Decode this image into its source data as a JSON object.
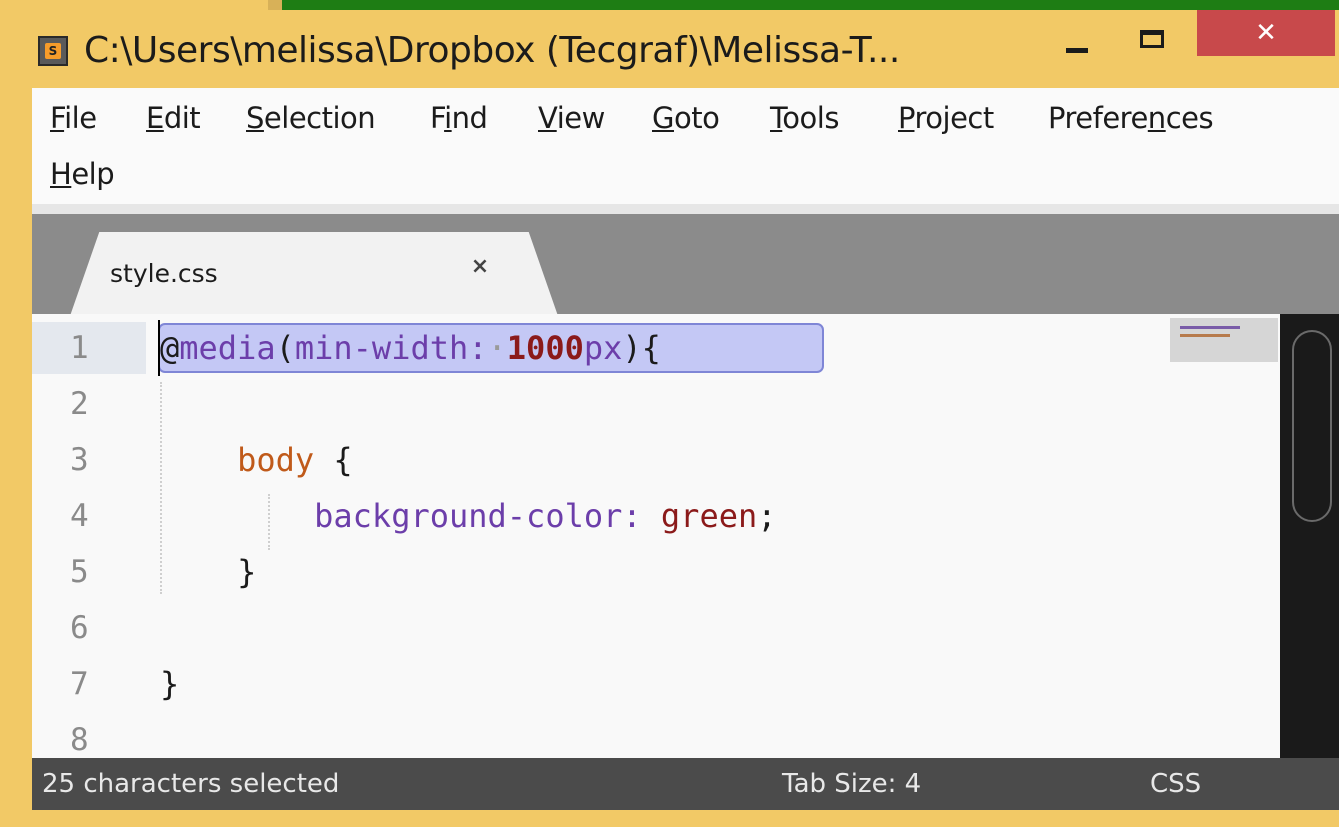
{
  "window": {
    "title": "C:\\Users\\melissa\\Dropbox (Tecgraf)\\Melissa-T...",
    "app_icon": "sublime-text-icon",
    "close_glyph": "✕"
  },
  "menu": {
    "items": [
      {
        "label": "File",
        "acc": "F"
      },
      {
        "label": "Edit",
        "acc": "E"
      },
      {
        "label": "Selection",
        "acc": "S"
      },
      {
        "label": "Find",
        "acc": "i"
      },
      {
        "label": "View",
        "acc": "V"
      },
      {
        "label": "Goto",
        "acc": "G"
      },
      {
        "label": "Tools",
        "acc": "T"
      },
      {
        "label": "Project",
        "acc": "P"
      },
      {
        "label": "Preferences",
        "acc": "n"
      },
      {
        "label": "Help",
        "acc": "H"
      }
    ]
  },
  "tab": {
    "label": "style.css",
    "close_glyph": "×"
  },
  "editor": {
    "line_numbers": [
      "1",
      "2",
      "3",
      "4",
      "5",
      "6",
      "7",
      "8"
    ],
    "selection_text": "@media(min-width: 1000px)"
  },
  "status": {
    "selection": "25 characters selected",
    "tab_size": "Tab Size: 4",
    "syntax": "CSS"
  },
  "colors": {
    "window_frame": "#f2c966",
    "close_button": "#c8494b",
    "status_bar": "#4b4b4b",
    "selection": "#c4c8f5"
  }
}
